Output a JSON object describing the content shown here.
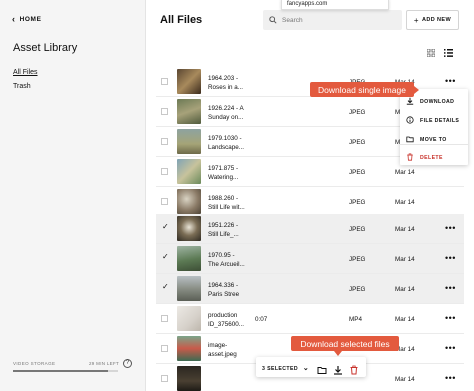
{
  "sidebar": {
    "home_label": "HOME",
    "title": "Asset Library",
    "nav": [
      {
        "label": "All Files",
        "active": true
      },
      {
        "label": "Trash",
        "active": false
      }
    ],
    "storage_label": "VIDEO STORAGE",
    "storage_remaining": "29 MIN LEFT",
    "storage_used_fraction": 0.9
  },
  "header": {
    "title": "All Files",
    "search_placeholder": "Search",
    "add_new_label": "ADD NEW",
    "tooltip_text": "fancyapps.com"
  },
  "files": [
    {
      "name_line1": "1964.203 -",
      "name_line2": "Roses in a...",
      "duration": "",
      "type": "JPEG",
      "date": "Mar 14",
      "selected": false
    },
    {
      "name_line1": "1926.224 - A",
      "name_line2": "Sunday on...",
      "duration": "",
      "type": "JPEG",
      "date": "Mar 14",
      "selected": false
    },
    {
      "name_line1": "1979.1030 -",
      "name_line2": "Landscape...",
      "duration": "",
      "type": "JPEG",
      "date": "Mar 14",
      "selected": false
    },
    {
      "name_line1": "1971.875 -",
      "name_line2": "Watering...",
      "duration": "",
      "type": "JPEG",
      "date": "Mar 14",
      "selected": false
    },
    {
      "name_line1": "1988.260 -",
      "name_line2": "Still Life wit...",
      "duration": "",
      "type": "JPEG",
      "date": "Mar 14",
      "selected": false
    },
    {
      "name_line1": "1951.226 -",
      "name_line2": "Still Life_...",
      "duration": "",
      "type": "JPEG",
      "date": "Mar 14",
      "selected": true
    },
    {
      "name_line1": "1970.95 -",
      "name_line2": "The Arcueil...",
      "duration": "",
      "type": "JPEG",
      "date": "Mar 14",
      "selected": true
    },
    {
      "name_line1": "1964.336 -",
      "name_line2": "Paris Stree",
      "duration": "",
      "type": "JPEG",
      "date": "Mar 14",
      "selected": true
    },
    {
      "name_line1": "production",
      "name_line2": "ID_375600...",
      "duration": "0:07",
      "type": "MP4",
      "date": "Mar 14",
      "selected": false
    },
    {
      "name_line1": "image-",
      "name_line2": "asset.jpeg",
      "duration": "",
      "type": "",
      "date": "Mar 14",
      "selected": false
    },
    {
      "name_line1": "",
      "name_line2": "",
      "duration": "",
      "type": "",
      "date": "Mar 14",
      "selected": false
    }
  ],
  "context_menu": {
    "download": "DOWNLOAD",
    "file_details": "FILE DETAILS",
    "move_to": "MOVE TO",
    "delete": "DELETE"
  },
  "callouts": {
    "single": "Download single image",
    "selected": "Download selected files"
  },
  "bulk_bar": {
    "count_label": "3 SELECTED"
  },
  "colors": {
    "accent": "#e35a3e",
    "delete": "#c8322b",
    "sidebar_bg": "#f5f5f5",
    "selected_row": "#efefef"
  },
  "icons": [
    "chevron-left-icon",
    "search-icon",
    "plus-icon",
    "grid-view-icon",
    "list-view-icon",
    "more-icon",
    "download-icon",
    "info-icon",
    "folder-icon",
    "trash-icon",
    "chevron-down-icon",
    "help-icon"
  ]
}
